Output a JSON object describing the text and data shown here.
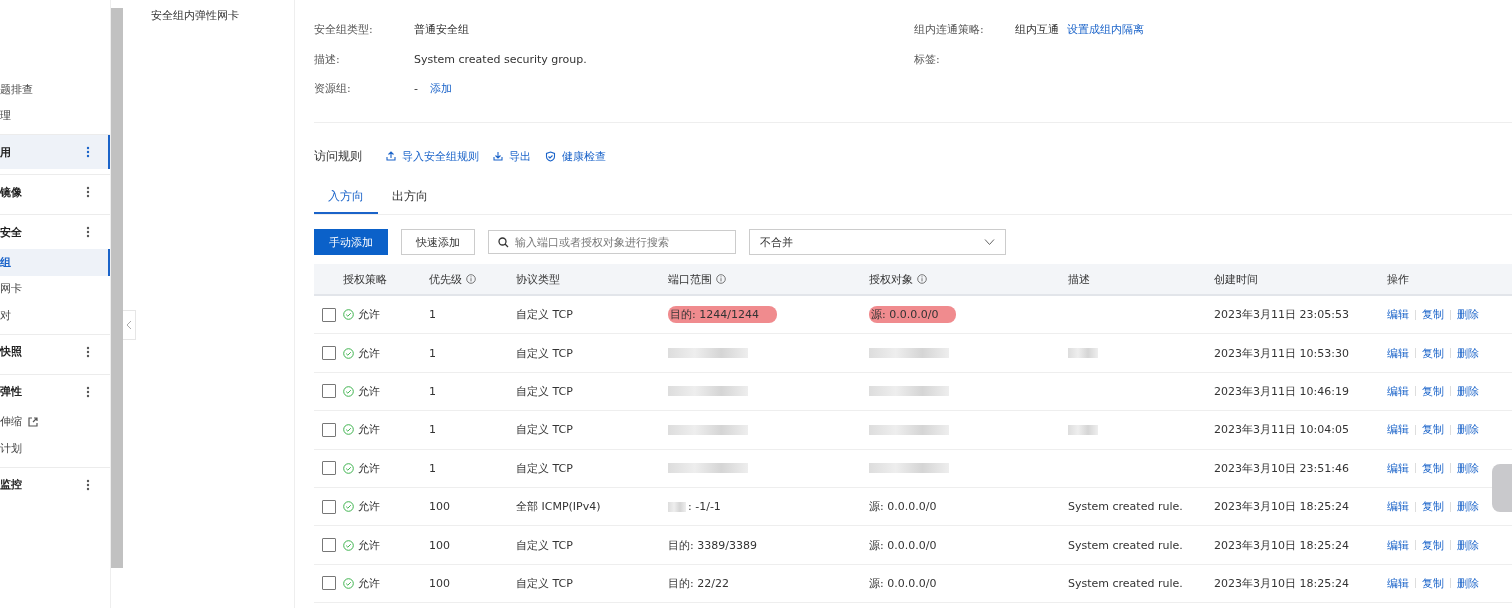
{
  "sidebar": {
    "sections": [
      {
        "kind": "items",
        "children": [
          {
            "label": "题排查",
            "selected": false,
            "external": false
          },
          {
            "label": "理",
            "selected": false,
            "external": false
          }
        ]
      },
      {
        "kind": "group",
        "label": "用",
        "selected": true
      },
      {
        "kind": "group",
        "label": "镜像",
        "selected": false
      },
      {
        "kind": "group",
        "label": "安全",
        "selected": false,
        "children": [
          {
            "label": "组",
            "selected": true,
            "external": false
          },
          {
            "label": "网卡",
            "selected": false,
            "external": false
          },
          {
            "label": "对",
            "selected": false,
            "external": false
          }
        ]
      },
      {
        "kind": "group",
        "label": "快照",
        "selected": false
      },
      {
        "kind": "group",
        "label": "弹性",
        "selected": false,
        "children": [
          {
            "label": "伸缩",
            "selected": false,
            "external": true
          },
          {
            "label": "计划",
            "selected": false,
            "external": false
          }
        ]
      },
      {
        "kind": "group",
        "label": "监控",
        "selected": false
      }
    ]
  },
  "submenu": {
    "items": [
      {
        "label": "安全组内弹性网卡"
      }
    ]
  },
  "details": {
    "left": [
      {
        "label": "安全组类型:",
        "value": "普通安全组"
      },
      {
        "label": "描述:",
        "value": "System created security group."
      },
      {
        "label": "资源组:",
        "value": "-",
        "link": "添加"
      }
    ],
    "right": [
      {
        "label": "组内连通策略:",
        "value": "组内互通",
        "link": "设置成组内隔离"
      },
      {
        "label": "标签:"
      }
    ]
  },
  "toolbar": {
    "title": "访问规则",
    "actions": [
      {
        "label": "导入安全组规则"
      },
      {
        "label": "导出"
      },
      {
        "label": "健康检查"
      }
    ]
  },
  "tabs": [
    {
      "label": "入方向",
      "selected": true
    },
    {
      "label": "出方向",
      "selected": false
    }
  ],
  "buttons": [
    {
      "label": "手动添加",
      "kind": "primary"
    },
    {
      "label": "快速添加",
      "kind": "default"
    }
  ],
  "search": {
    "placeholder": "输入端口或者授权对象进行搜索"
  },
  "merge_select": {
    "value": "不合并"
  },
  "table": {
    "columns": [
      {
        "label": "授权策略",
        "info": false
      },
      {
        "label": "优先级",
        "info": true
      },
      {
        "label": "协议类型",
        "info": false
      },
      {
        "label": "端口范围",
        "info": true
      },
      {
        "label": "授权对象",
        "info": true
      },
      {
        "label": "描述",
        "info": false
      },
      {
        "label": "创建时间",
        "info": false
      },
      {
        "label": "操作",
        "info": false
      }
    ],
    "rows": [
      {
        "checked": false,
        "policy": "允许",
        "priority": "1",
        "protocol": "自定义 TCP",
        "port": {
          "kind": "text",
          "text": "目的: 1244/1244",
          "highlighted": true
        },
        "target": {
          "kind": "text",
          "text": "源: 0.0.0.0/0",
          "highlighted": true
        },
        "description": {
          "kind": "empty"
        },
        "time": "2023年3月11日 23:05:53",
        "actions": [
          "编辑",
          "复制",
          "删除"
        ]
      },
      {
        "checked": false,
        "policy": "允许",
        "priority": "1",
        "protocol": "自定义 TCP",
        "port": {
          "kind": "blurred",
          "highlighted": false
        },
        "target": {
          "kind": "blurred",
          "highlighted": false
        },
        "description": {
          "kind": "blurred"
        },
        "time": "2023年3月11日 10:53:30",
        "actions": [
          "编辑",
          "复制",
          "删除"
        ]
      },
      {
        "checked": false,
        "policy": "允许",
        "priority": "1",
        "protocol": "自定义 TCP",
        "port": {
          "kind": "blurred",
          "highlighted": false
        },
        "target": {
          "kind": "blurred",
          "highlighted": false
        },
        "description": {
          "kind": "empty"
        },
        "time": "2023年3月11日 10:46:19",
        "actions": [
          "编辑",
          "复制",
          "删除"
        ]
      },
      {
        "checked": false,
        "policy": "允许",
        "priority": "1",
        "protocol": "自定义 TCP",
        "port": {
          "kind": "blurred",
          "highlighted": false
        },
        "target": {
          "kind": "blurred",
          "highlighted": false
        },
        "description": {
          "kind": "blurred"
        },
        "time": "2023年3月11日 10:04:05",
        "actions": [
          "编辑",
          "复制",
          "删除"
        ]
      },
      {
        "checked": false,
        "policy": "允许",
        "priority": "1",
        "protocol": "自定义 TCP",
        "port": {
          "kind": "blurred",
          "highlighted": false
        },
        "target": {
          "kind": "blurred",
          "highlighted": false
        },
        "description": {
          "kind": "empty"
        },
        "time": "2023年3月10日 23:51:46",
        "actions": [
          "编辑",
          "复制",
          "删除"
        ]
      },
      {
        "checked": false,
        "policy": "允许",
        "priority": "100",
        "protocol": "全部 ICMP(IPv4)",
        "port": {
          "kind": "partly_blurred",
          "text": ": -1/-1",
          "highlighted": false
        },
        "target": {
          "kind": "text",
          "text": "源: 0.0.0.0/0",
          "highlighted": false
        },
        "description": {
          "kind": "text",
          "text": "System created rule."
        },
        "time": "2023年3月10日 18:25:24",
        "actions": [
          "编辑",
          "复制",
          "删除"
        ]
      },
      {
        "checked": false,
        "policy": "允许",
        "priority": "100",
        "protocol": "自定义 TCP",
        "port": {
          "kind": "text",
          "text": "目的: 3389/3389",
          "highlighted": false
        },
        "target": {
          "kind": "text",
          "text": "源: 0.0.0.0/0",
          "highlighted": false
        },
        "description": {
          "kind": "text",
          "text": "System created rule."
        },
        "time": "2023年3月10日 18:25:24",
        "actions": [
          "编辑",
          "复制",
          "删除"
        ]
      },
      {
        "checked": false,
        "policy": "允许",
        "priority": "100",
        "protocol": "自定义 TCP",
        "port": {
          "kind": "text",
          "text": "目的: 22/22",
          "highlighted": false
        },
        "target": {
          "kind": "text",
          "text": "源: 0.0.0.0/0",
          "highlighted": false
        },
        "description": {
          "kind": "text",
          "text": "System created rule."
        },
        "time": "2023年3月10日 18:25:24",
        "actions": [
          "编辑",
          "复制",
          "删除"
        ]
      }
    ]
  }
}
